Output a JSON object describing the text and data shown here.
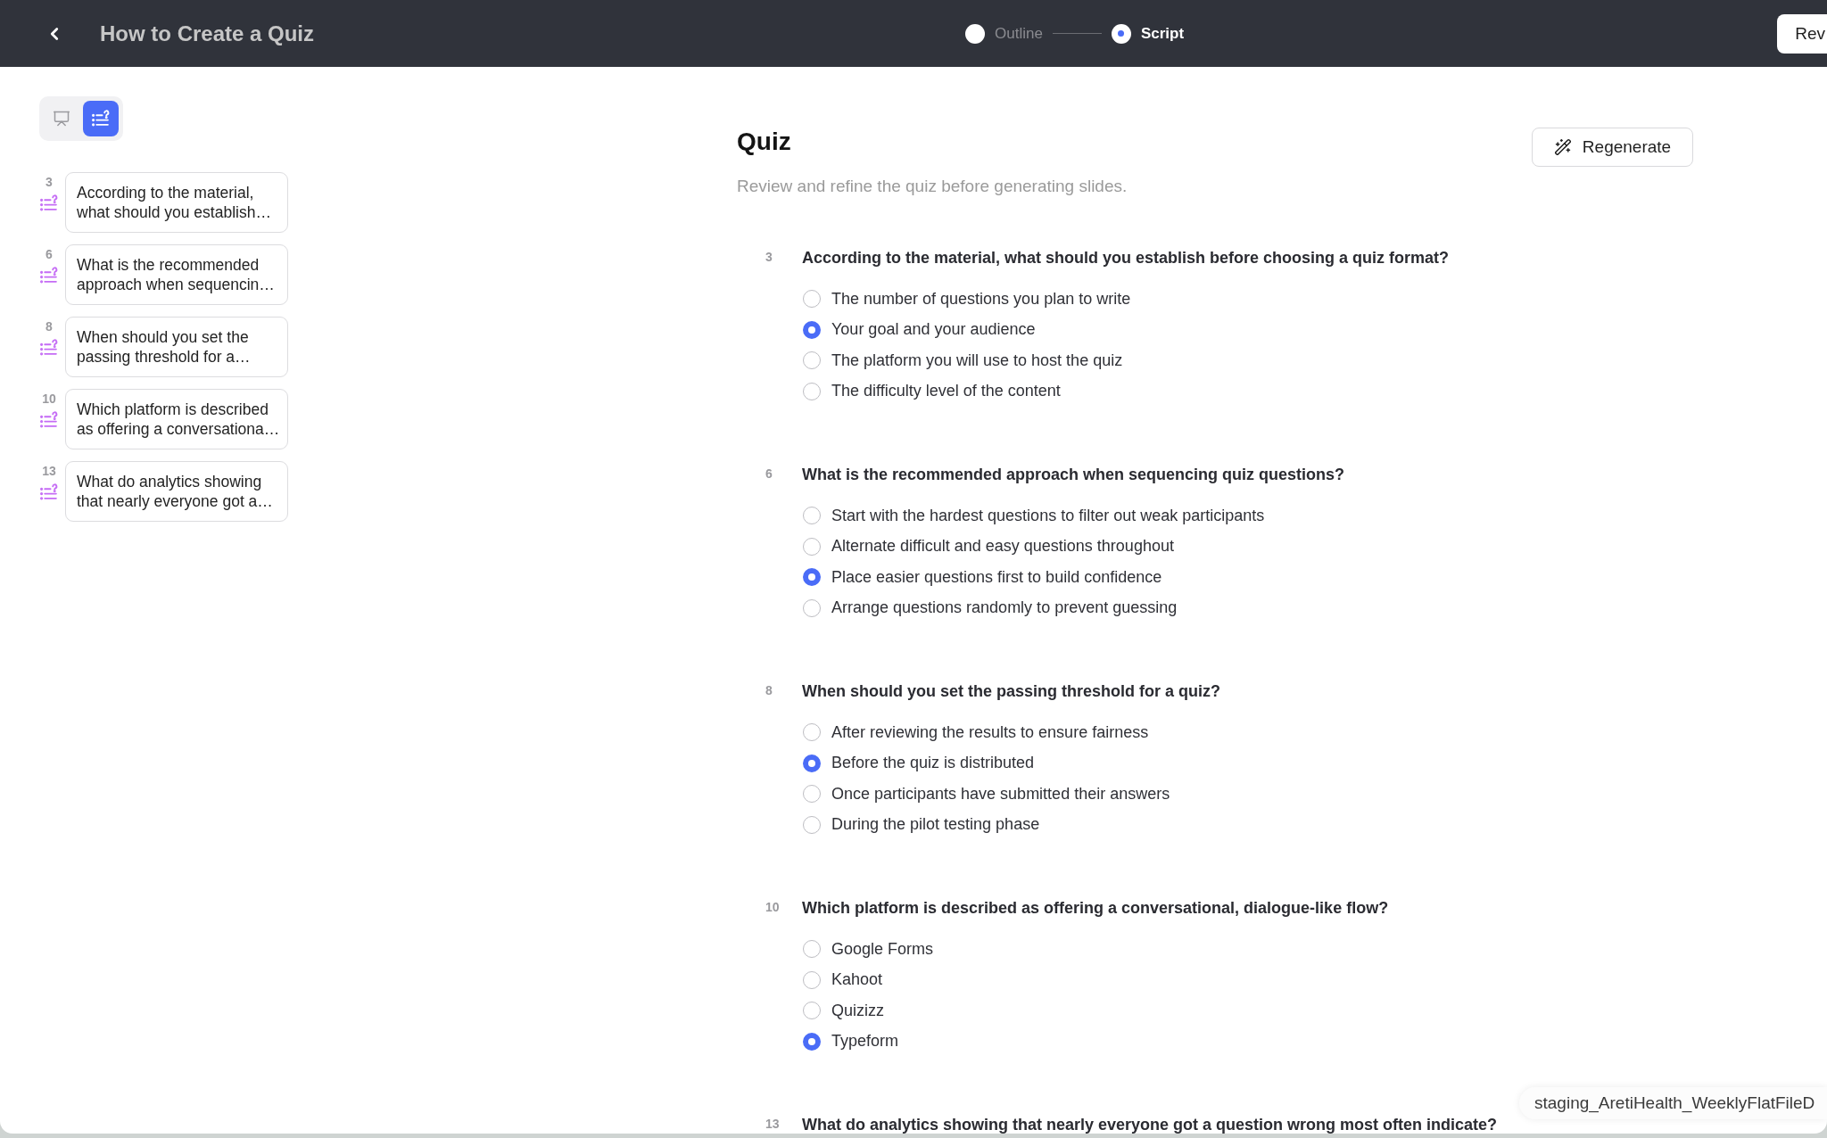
{
  "header": {
    "title": "How to Create a Quiz",
    "steps": [
      {
        "label": "Outline",
        "selected": false
      },
      {
        "label": "Script",
        "selected": true
      }
    ],
    "action_button": "Rev"
  },
  "sidebar": {
    "view_toggle": [
      {
        "kind": "slides",
        "selected": false
      },
      {
        "kind": "quiz",
        "selected": true
      }
    ],
    "items": [
      {
        "number": "3",
        "text": "According to the material, what should you establish…"
      },
      {
        "number": "6",
        "text": "What is the recommended approach when sequencin…"
      },
      {
        "number": "8",
        "text": "When should you set the passing threshold for a…"
      },
      {
        "number": "10",
        "text": "Which platform is described as offering a conversationa…"
      },
      {
        "number": "13",
        "text": "What do analytics showing that nearly everyone got a…"
      }
    ]
  },
  "quiz": {
    "title": "Quiz",
    "subtitle": "Review and refine the quiz before generating slides.",
    "regenerate_button": "Regenerate",
    "questions": [
      {
        "number": "3",
        "text": "According to the material, what should you establish before choosing a quiz format?",
        "options": [
          {
            "text": "The number of questions you plan to write",
            "selected": false
          },
          {
            "text": "Your goal and your audience",
            "selected": true
          },
          {
            "text": "The platform you will use to host the quiz",
            "selected": false
          },
          {
            "text": "The difficulty level of the content",
            "selected": false
          }
        ]
      },
      {
        "number": "6",
        "text": "What is the recommended approach when sequencing quiz questions?",
        "options": [
          {
            "text": "Start with the hardest questions to filter out weak participants",
            "selected": false
          },
          {
            "text": "Alternate difficult and easy questions throughout",
            "selected": false
          },
          {
            "text": "Place easier questions first to build confidence",
            "selected": true
          },
          {
            "text": "Arrange questions randomly to prevent guessing",
            "selected": false
          }
        ]
      },
      {
        "number": "8",
        "text": "When should you set the passing threshold for a quiz?",
        "options": [
          {
            "text": "After reviewing the results to ensure fairness",
            "selected": false
          },
          {
            "text": "Before the quiz is distributed",
            "selected": true
          },
          {
            "text": "Once participants have submitted their answers",
            "selected": false
          },
          {
            "text": "During the pilot testing phase",
            "selected": false
          }
        ]
      },
      {
        "number": "10",
        "text": "Which platform is described as offering a conversational, dialogue-like flow?",
        "options": [
          {
            "text": "Google Forms",
            "selected": false
          },
          {
            "text": "Kahoot",
            "selected": false
          },
          {
            "text": "Quizizz",
            "selected": false
          },
          {
            "text": "Typeform",
            "selected": true
          }
        ]
      },
      {
        "number": "13",
        "text": "What do analytics showing that nearly everyone got a question wrong most often indicate?"
      }
    ]
  },
  "dock_tooltip": "staging_AretiHealth_WeeklyFlatFileD"
}
